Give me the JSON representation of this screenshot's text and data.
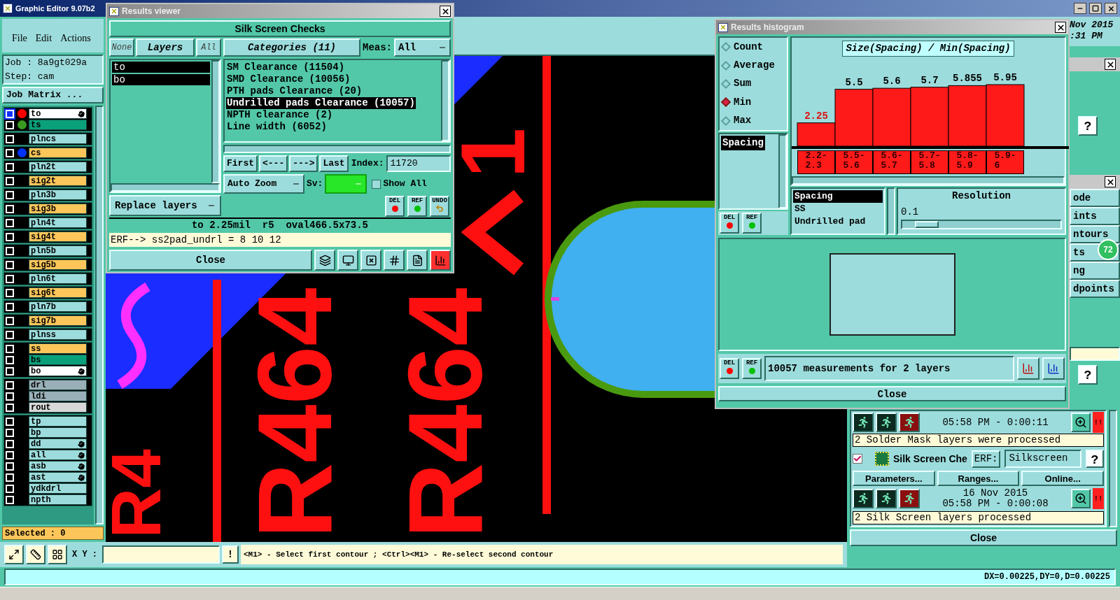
{
  "main_window": {
    "title": "Graphic Editor 9.07b2",
    "menu": [
      "File",
      "Edit",
      "Actions"
    ],
    "job": "Job : 8a9gt029a",
    "step": "Step: cam",
    "job_matrix": "Job Matrix ..."
  },
  "layer_groups": [
    {
      "layers": [
        {
          "name": "to",
          "color": "#ffffff",
          "dot": {
            "color": "#ff0000"
          },
          "hand": true,
          "active": true
        },
        {
          "name": "ts",
          "color": "#0aa07a",
          "dot": {
            "color": "#3a9a20"
          },
          "hand": false,
          "active": false
        }
      ]
    },
    {
      "layers": [
        {
          "name": "plncs",
          "color": "#9ddcdc",
          "hand": false,
          "active": false
        }
      ]
    },
    {
      "layers": [
        {
          "name": "cs",
          "color": "#fcc65a",
          "dot": {
            "color": "#0033ff"
          },
          "hand": false,
          "active": false
        }
      ]
    },
    {
      "layers": [
        {
          "name": "pln2t",
          "color": "#9ddcdc",
          "hand": false,
          "active": false
        }
      ]
    },
    {
      "layers": [
        {
          "name": "sig2t",
          "color": "#fcc65a",
          "hand": false,
          "active": false
        }
      ]
    },
    {
      "layers": [
        {
          "name": "pln3b",
          "color": "#9ddcdc",
          "hand": false,
          "active": false
        }
      ]
    },
    {
      "layers": [
        {
          "name": "sig3b",
          "color": "#fcc65a",
          "hand": false,
          "active": false
        }
      ]
    },
    {
      "layers": [
        {
          "name": "pln4t",
          "color": "#9ddcdc",
          "hand": false,
          "active": false
        }
      ]
    },
    {
      "layers": [
        {
          "name": "sig4t",
          "color": "#fcc65a",
          "hand": false,
          "active": false
        }
      ]
    },
    {
      "layers": [
        {
          "name": "pln5b",
          "color": "#9ddcdc",
          "hand": false,
          "active": false
        }
      ]
    },
    {
      "layers": [
        {
          "name": "sig5b",
          "color": "#fcc65a",
          "hand": false,
          "active": false
        }
      ]
    },
    {
      "layers": [
        {
          "name": "pln6t",
          "color": "#9ddcdc",
          "hand": false,
          "active": false
        }
      ]
    },
    {
      "layers": [
        {
          "name": "sig6t",
          "color": "#fcc65a",
          "hand": false,
          "active": false
        }
      ]
    },
    {
      "layers": [
        {
          "name": "pln7b",
          "color": "#9ddcdc",
          "hand": false,
          "active": false
        }
      ]
    },
    {
      "layers": [
        {
          "name": "sig7b",
          "color": "#fcc65a",
          "hand": false,
          "active": false
        }
      ]
    },
    {
      "layers": [
        {
          "name": "plnss",
          "color": "#9ddcdc",
          "hand": false,
          "active": false
        }
      ]
    },
    {
      "layers": [
        {
          "name": "ss",
          "color": "#fcc65a",
          "hand": false,
          "active": false
        },
        {
          "name": "bs",
          "color": "#0aa07a",
          "hand": false,
          "active": false
        },
        {
          "name": "bo",
          "color": "#ffffff",
          "hand": true,
          "active": false
        }
      ]
    },
    {
      "layers": [
        {
          "name": "drl",
          "color": "#9ab0b8",
          "hand": false,
          "active": false
        },
        {
          "name": "ldi",
          "color": "#9ab0b8",
          "hand": false,
          "active": false
        },
        {
          "name": "rout",
          "color": "#d8d8d8",
          "hand": false,
          "active": false
        }
      ]
    },
    {
      "layers": [
        {
          "name": "tp",
          "color": "#9ddcdc",
          "hand": false,
          "active": false
        },
        {
          "name": "bp",
          "color": "#9ddcdc",
          "hand": false,
          "active": false
        },
        {
          "name": "dd",
          "color": "#9ddcdc",
          "hand": true,
          "active": false
        },
        {
          "name": "all",
          "color": "#9ddcdc",
          "hand": true,
          "active": false
        },
        {
          "name": "asb",
          "color": "#9ddcdc",
          "hand": true,
          "active": false
        },
        {
          "name": "ast",
          "color": "#9ddcdc",
          "hand": true,
          "active": false
        },
        {
          "name": "ydkdrl",
          "color": "#9ddcdc",
          "hand": false,
          "active": false
        },
        {
          "name": "npth",
          "color": "#9ddcdc",
          "hand": false,
          "active": false
        }
      ]
    }
  ],
  "selected_count": "Selected : 0",
  "canvas": {
    "labels": [
      "R4",
      "R464",
      "R464",
      "1"
    ]
  },
  "toolbar": {
    "xy_label": "X Y :",
    "alert_button": "!",
    "prompt": "<M1> - Select first contour ; <Ctrl><M1> - Re-select second contour"
  },
  "status_bar": "DX=0.00225,DY=0,D=0.00225",
  "right_panel": {
    "date": "Nov 2015",
    "time": ":31 PM",
    "help_buttons": [
      "?",
      "?"
    ],
    "menu_items": [
      "ode",
      "ints",
      "ntours",
      "ts",
      "ng",
      "dpoints"
    ],
    "badge": "72",
    "runs": [
      {
        "time": "05:58 PM - 0:00:11",
        "alert": "!!",
        "message": "2 Solder Mask layers were processed"
      }
    ],
    "check": {
      "checked": true,
      "title": "Silk Screen Che",
      "erf_label": "ERF:",
      "erf_value": "Silkscreen",
      "help": "?",
      "buttons": [
        "Parameters...",
        "Ranges...",
        "Online..."
      ],
      "date": "16 Nov 2015",
      "time": "05:58 PM - 0:00:08",
      "alert": "!!",
      "message": "2 Silk Screen layers processed"
    },
    "close": "Close"
  },
  "results_viewer": {
    "title": "Results viewer",
    "heading": "Silk Screen Checks",
    "layer_tabs": [
      {
        "label": "None",
        "selected": false
      },
      {
        "label": "Layers",
        "selected": true
      },
      {
        "label": "All",
        "selected": false
      }
    ],
    "layers": [
      {
        "name": "to",
        "selected": true
      },
      {
        "name": "bo",
        "selected": true
      }
    ],
    "replace_mode": "Replace layers",
    "categories_button": "Categories (11)",
    "meas_label": "Meas:",
    "meas_value": "All",
    "categories": [
      {
        "label": "SM Clearance (11504)",
        "selected": false
      },
      {
        "label": "SMD Clearance (10056)",
        "selected": false
      },
      {
        "label": "PTH pads Clearance (20)",
        "selected": false
      },
      {
        "label": "Undrilled pads Clearance (10057)",
        "selected": true
      },
      {
        "label": "NPTH clearance (2)",
        "selected": false
      },
      {
        "label": "Line width (6052)",
        "selected": false
      }
    ],
    "nav_buttons": [
      "First",
      "<---",
      "--->",
      "Last"
    ],
    "index_label": "Index:",
    "index_value": "11720",
    "zoom_mode": "Auto Zoom",
    "sv_label": "Sv:",
    "show_all": {
      "label": "Show All",
      "checked": false
    },
    "edit_buttons": [
      {
        "label": "DEL",
        "kind": "dot",
        "color": "#ff0000"
      },
      {
        "label": "REF",
        "kind": "dot",
        "color": "#00c000"
      },
      {
        "label": "UNDO",
        "kind": "undo"
      }
    ],
    "info": "to 2.25mil  r5  oval466.5x73.5",
    "erf_line": "ERF--> ss2pad_undrl = 8 10 12",
    "close": "Close"
  },
  "results_histogram": {
    "title": "Results histogram",
    "aggregates": [
      {
        "label": "Count",
        "selected": false
      },
      {
        "label": "Average",
        "selected": false
      },
      {
        "label": "Sum",
        "selected": false
      },
      {
        "label": "Min",
        "selected": true
      },
      {
        "label": "Max",
        "selected": false
      }
    ],
    "measures": [
      {
        "label": "Spacing",
        "selected": true
      }
    ],
    "side_buttons": [
      {
        "label": "DEL",
        "kind": "dot",
        "color": "#ff0000"
      },
      {
        "label": "REF",
        "kind": "dot",
        "color": "#00c000"
      }
    ],
    "chart_data": {
      "type": "bar",
      "title": "Size(Spacing) / Min(Spacing)",
      "categories": [
        "2.2-2.3",
        "5.5-5.6",
        "5.6-5.7",
        "5.7-5.8",
        "5.8-5.9",
        "5.9-6"
      ],
      "values": [
        2.25,
        5.5,
        5.6,
        5.7,
        5.855,
        5.95
      ],
      "data_labels": true
    },
    "attributes": [
      {
        "label": "Spacing",
        "selected": true
      },
      {
        "label": "SS",
        "selected": false
      },
      {
        "label": "Undrilled pad",
        "selected": false
      }
    ],
    "resolution": {
      "label": "Resolution",
      "value": "0.1",
      "level": 0.08
    },
    "bottom_buttons": [
      {
        "label": "DEL",
        "kind": "dot",
        "color": "#ff0000"
      },
      {
        "label": "REF",
        "kind": "dot",
        "color": "#00c000"
      }
    ],
    "summary": "10057 measurements for 2 layers",
    "close": "Close"
  }
}
